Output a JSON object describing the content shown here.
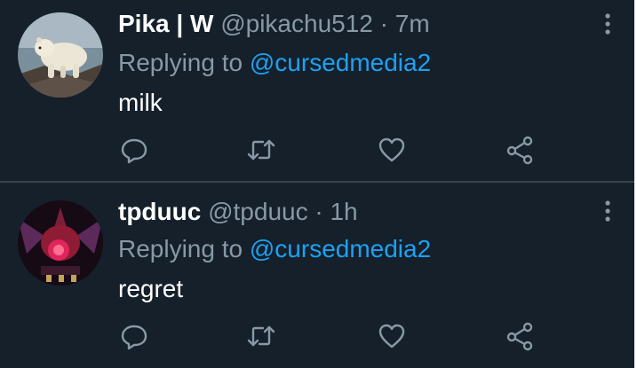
{
  "tweets": [
    {
      "display_name": "Pika | W",
      "handle": "@pikachu512",
      "separator": "·",
      "time": "7m",
      "replying_prefix": "Replying to",
      "replying_to": "@cursedmedia2",
      "text": "milk",
      "avatar_icon": "polar-bear-photo"
    },
    {
      "display_name": "tpduuc",
      "handle": "@tpduuc",
      "separator": "·",
      "time": "1h",
      "replying_prefix": "Replying to",
      "replying_to": "@cursedmedia2",
      "text": "regret",
      "avatar_icon": "red-creature-photo"
    }
  ],
  "icons": {
    "reply": "reply-icon",
    "retweet": "retweet-icon",
    "like": "heart-icon",
    "share": "share-icon",
    "more": "more-vertical-icon"
  },
  "colors": {
    "background": "#15202b",
    "divider": "#38444d",
    "secondary_text": "#8899a6",
    "mention": "#1da1f2"
  }
}
